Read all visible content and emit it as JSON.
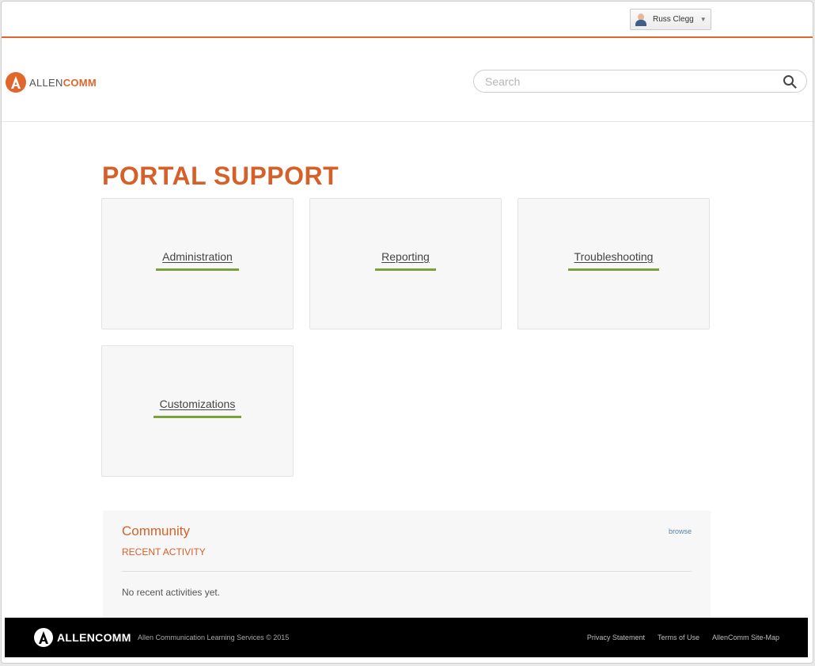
{
  "user": {
    "name": "Russ Clegg",
    "dropdown_icon": "caret-down-icon"
  },
  "header": {
    "logo": {
      "prefix": "ALLEN",
      "suffix": "COMM"
    },
    "search": {
      "placeholder": "Search",
      "value": ""
    }
  },
  "main": {
    "title": "PORTAL SUPPORT",
    "categories": [
      {
        "label": "Administration"
      },
      {
        "label": "Reporting"
      },
      {
        "label": "Troubleshooting"
      },
      {
        "label": "Customizations"
      }
    ]
  },
  "community": {
    "title": "Community",
    "subtitle": "RECENT ACTIVITY",
    "browse_label": "browse",
    "empty_text": "No recent activities yet."
  },
  "footer": {
    "brand": "ALLENCOMM",
    "copyright": "Allen Communication Learning Services © 2015",
    "links": [
      "Privacy Statement",
      "Terms of Use",
      "AllenComm Site-Map"
    ]
  },
  "colors": {
    "accent": "#e0662c",
    "title": "#d6602a",
    "underline": "#7aa23a",
    "footer_bg": "#000000"
  }
}
